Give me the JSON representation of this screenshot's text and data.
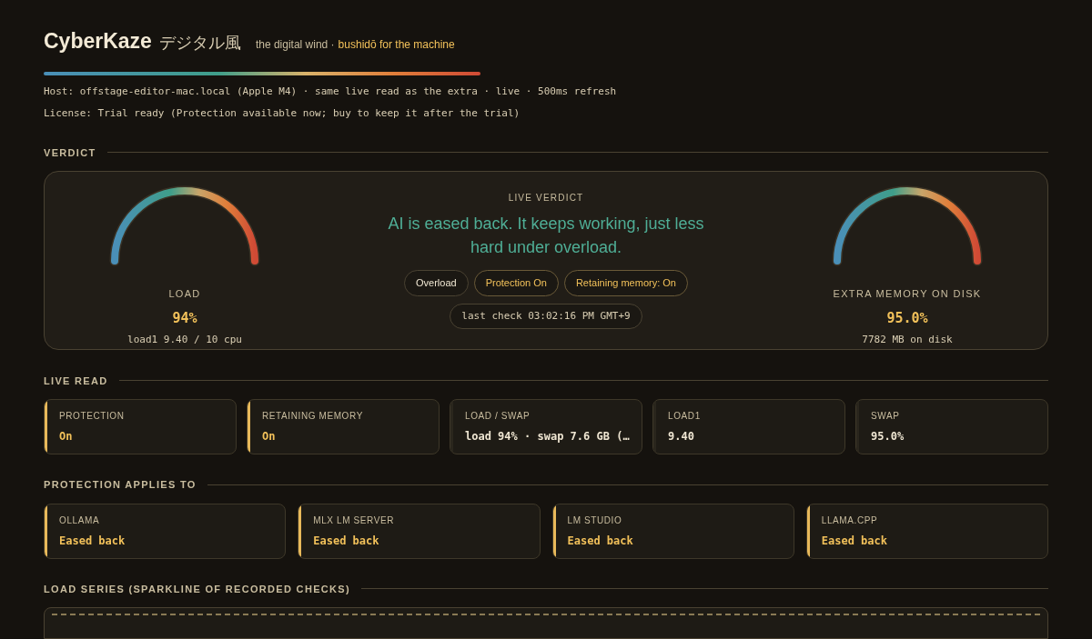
{
  "header": {
    "title": "CyberKaze",
    "title_jp": "デジタル風",
    "tagline": "the digital wind ·",
    "tagline_accent": "bushidō for the machine",
    "host": "Host: offstage-editor-mac.local (Apple M4) · same live read as the extra · live · 500ms refresh",
    "license": "License: Trial ready (Protection available now; buy to keep it after the trial)"
  },
  "verdict": {
    "heading": "VERDICT",
    "gauges": [
      {
        "label": "LOAD",
        "value": "94%",
        "detail": "load1 9.40 / 10 cpu"
      },
      {
        "label": "EXTRA MEMORY ON DISK",
        "value": "95.0%",
        "detail": "7782 MB on disk"
      }
    ],
    "live_label": "LIVE VERDICT",
    "message": "AI is eased back. It keeps working, just less hard under overload.",
    "chips": [
      {
        "text": "Overload",
        "kind": "neutral"
      },
      {
        "text": "Protection On",
        "kind": "accent"
      },
      {
        "text": "Retaining memory: On",
        "kind": "accent"
      }
    ],
    "last_check": "last check 03:02:16 PM GMT+9"
  },
  "live_read": {
    "heading": "LIVE READ",
    "cards": [
      {
        "label": "PROTECTION",
        "value": "On",
        "highlighted": true
      },
      {
        "label": "RETAINING MEMORY",
        "value": "On",
        "highlighted": true
      },
      {
        "label": "LOAD / SWAP",
        "value": "load 94% · swap 7.6 GB (…",
        "highlighted": false
      },
      {
        "label": "LOAD1",
        "value": "9.40",
        "highlighted": false
      },
      {
        "label": "SWAP",
        "value": "95.0%",
        "highlighted": false
      }
    ]
  },
  "protection": {
    "heading": "PROTECTION APPLIES TO",
    "cards": [
      {
        "label": "OLLAMA",
        "value": "Eased back",
        "highlighted": true
      },
      {
        "label": "MLX LM SERVER",
        "value": "Eased back",
        "highlighted": true
      },
      {
        "label": "LM STUDIO",
        "value": "Eased back",
        "highlighted": true
      },
      {
        "label": "LLAMA.CPP",
        "value": "Eased back",
        "highlighted": true
      }
    ]
  },
  "load_series": {
    "heading": "LOAD SERIES (SPARKLINE OF RECORDED CHECKS)"
  }
}
